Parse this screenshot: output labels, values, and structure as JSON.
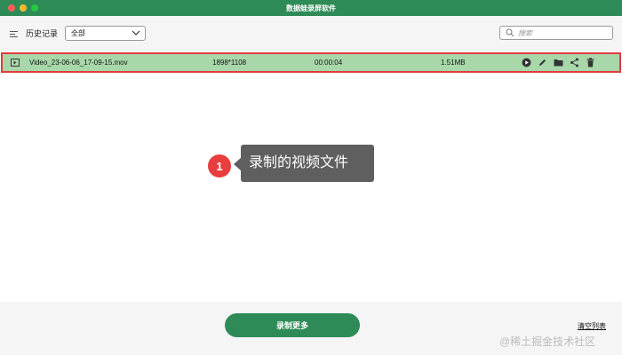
{
  "window": {
    "title": "数据蛙录屏软件"
  },
  "toolbar": {
    "history_label": "历史记录",
    "filter_selected": "全部",
    "search_placeholder": "搜索"
  },
  "recordings": [
    {
      "name": "Video_23-06-06_17-09-15.mov",
      "resolution": "1898*1108",
      "duration": "00:00:04",
      "size": "1.51MB"
    }
  ],
  "annotation": {
    "step": "1",
    "text": "录制的视频文件"
  },
  "footer": {
    "record_more_label": "录制更多",
    "clear_list_label": "清空列表"
  },
  "watermark": "@稀土掘金技术社区",
  "colors": {
    "accent": "#2e8b57",
    "selected_row": "#a8d8a9",
    "highlight_border": "#e23b3b",
    "badge": "#e83e3e",
    "callout_bg": "#5f5f5f"
  },
  "icons": {
    "row": [
      "video-file-icon",
      "play-icon",
      "edit-icon",
      "folder-icon",
      "share-icon",
      "trash-icon"
    ],
    "toolbar": [
      "menu-list-icon",
      "chevron-down-icon",
      "search-icon"
    ]
  }
}
